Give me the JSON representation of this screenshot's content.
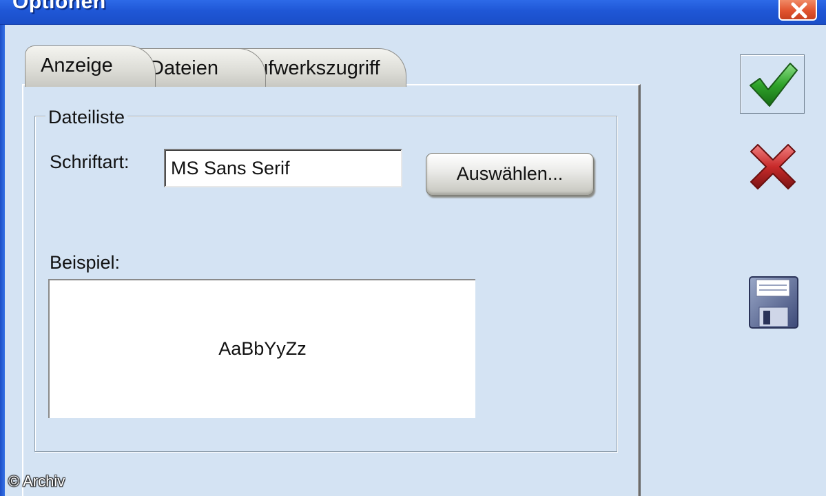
{
  "window": {
    "title": "Optionen",
    "close_icon": "close-icon",
    "accent_color": "#1f57d6",
    "close_color": "#e1542f"
  },
  "tabs": [
    {
      "label": "Anzeige",
      "active": true
    },
    {
      "label": "Dateien",
      "active": false
    },
    {
      "label": "Laufwerkszugriff",
      "active": false
    }
  ],
  "group": {
    "title": "Dateiliste",
    "font_label": "Schriftart:",
    "font_value": "MS Sans Serif",
    "choose_label": "Auswählen...",
    "preview_label": "Beispiel:",
    "preview_text": "AaBbYyZz"
  },
  "actions": {
    "ok_icon": "checkmark-icon",
    "cancel_icon": "cross-icon",
    "save_icon": "floppy-disk-icon"
  },
  "watermark": "© Archiv"
}
